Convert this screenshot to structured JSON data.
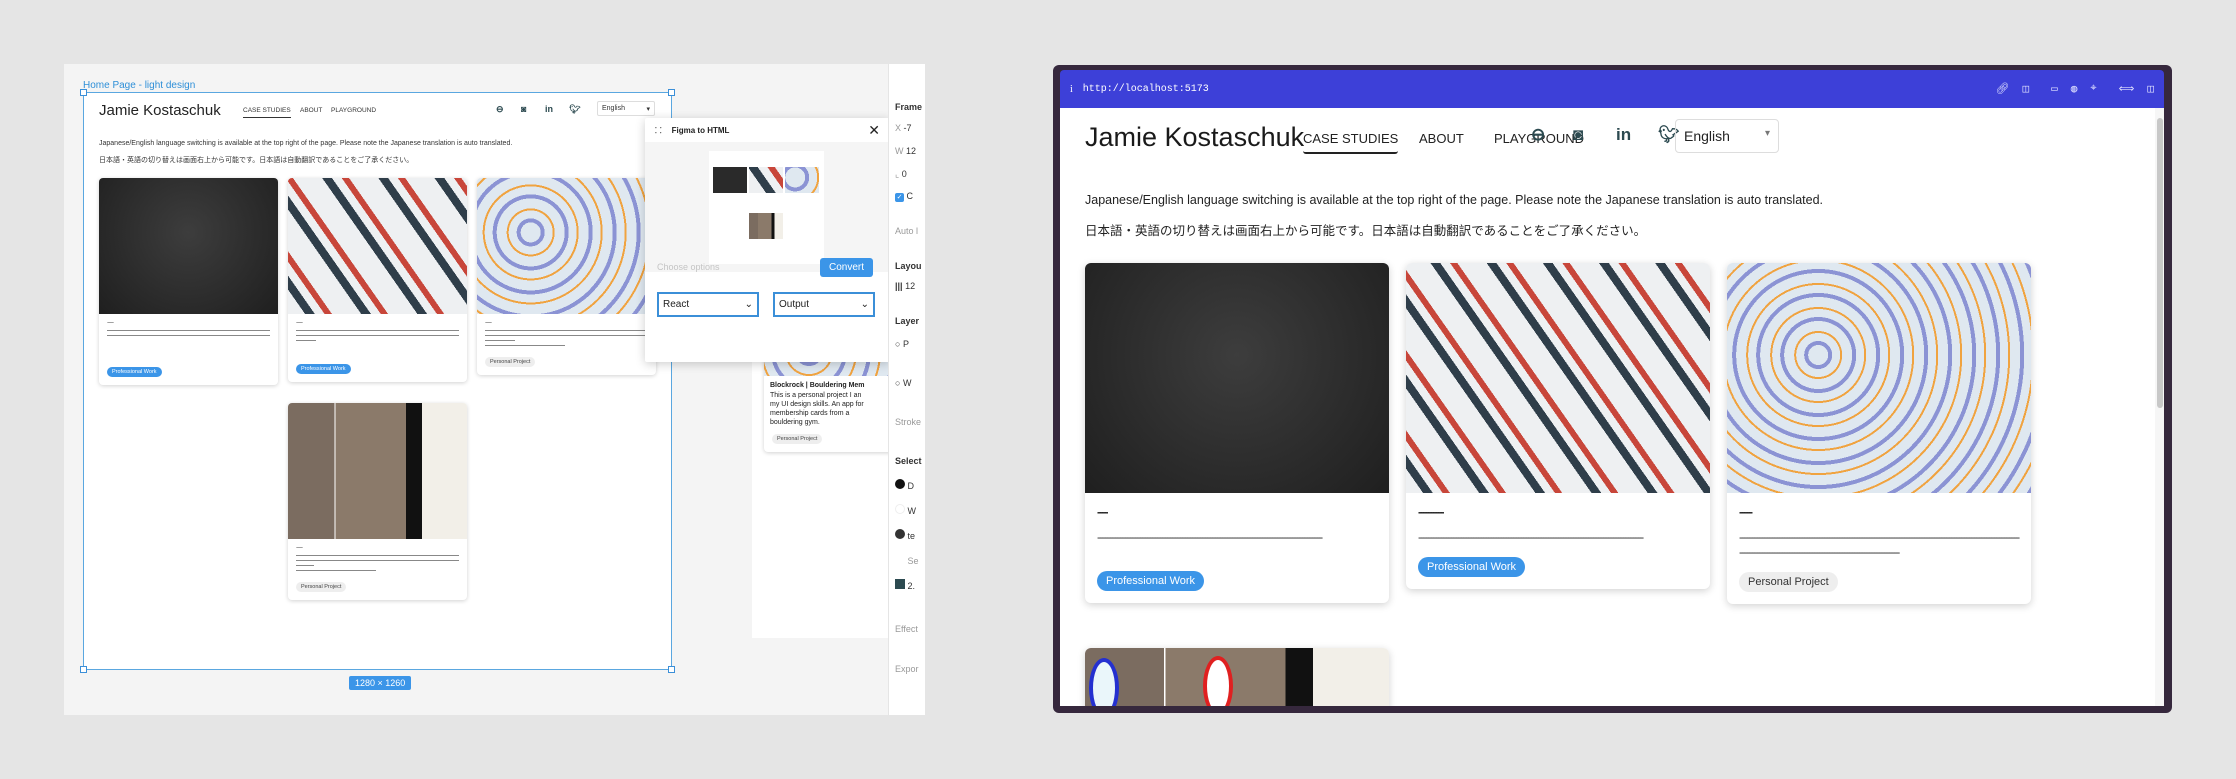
{
  "figma": {
    "frame_label": "Home Page - light design",
    "frame_size": "1280 × 1260",
    "design": {
      "name": "Jamie Kostaschuk",
      "nav": [
        "CASE STUDIES",
        "ABOUT",
        "PLAYGROUND"
      ],
      "language": "English",
      "notice_en": "Japanese/English language switching is available at the top right of the page. Please note the Japanese translation is auto translated.",
      "notice_ja": "日本語・英語の切り替えは画面右上から可能です。日本語は自動翻訳であることをご了承ください。",
      "cards": [
        {
          "badge": "Professional Work",
          "type": "blue"
        },
        {
          "badge": "Professional Work",
          "type": "blue"
        },
        {
          "badge": "Personal Project",
          "type": "grey"
        },
        {
          "badge": "Personal Project",
          "type": "grey"
        }
      ],
      "peek_card": {
        "title": "Blockrock | Bouldering Mem",
        "desc": "This is a personal project I an my UI design skills. An app for membership cards from a bouldering gym.",
        "badge": "Personal Project"
      }
    },
    "plugin": {
      "title": "Figma to HTML",
      "choose_label": "Choose options",
      "convert_label": "Convert",
      "framework": "React",
      "output": "Output"
    },
    "sidebar": {
      "frame": "Frame",
      "x_label": "X",
      "x_value": "-7",
      "w_label": "W",
      "w_value": "12",
      "r_value": "0",
      "clip_label": "C",
      "auto_layout": "Auto l",
      "layout_grid": "Layou",
      "grid_value": "12",
      "layer": "Layer",
      "layer_item1": "P",
      "layer_item2": "W",
      "stroke": "Stroke",
      "selection_colors": "Select",
      "colors": [
        {
          "label": "D",
          "hex": "#111111"
        },
        {
          "label": "W",
          "hex": "#ffffff"
        },
        {
          "label": "te",
          "hex": "#333333"
        },
        {
          "label": "Se",
          "hex": "#f5f5f5"
        },
        {
          "label": "2.",
          "hex": "#2c4a50"
        }
      ],
      "effects": "Effect",
      "export": "Expor"
    }
  },
  "browser": {
    "url": "http://localhost:5173",
    "name": "Jamie Kostaschuk",
    "nav": [
      "CASE STUDIES",
      "ABOUT",
      "PLAYGROUND"
    ],
    "language": "English",
    "notice_en": "Japanese/English language switching is available at the top right of the page. Please note the Japanese translation is auto translated.",
    "notice_ja": "日本語・英語の切り替えは画面右上から可能です。日本語は自動翻訳であることをご了承ください。",
    "cards": [
      {
        "title": "----",
        "desc": "------------------------------------------------------------------------------------------",
        "badge": "Professional Work"
      },
      {
        "title": "----------",
        "desc": "------------------------------------------------------------------------------------------",
        "badge": "Professional Work"
      },
      {
        "title": "-----",
        "desc": "--------------------------------------------------------------------------------------------------------------------------------------------------------------------------------",
        "badge": "Personal Project"
      }
    ]
  },
  "colors": {
    "accent": "#3b95e8",
    "urlbar": "#3d40d8",
    "icon": "#2c4a50"
  }
}
